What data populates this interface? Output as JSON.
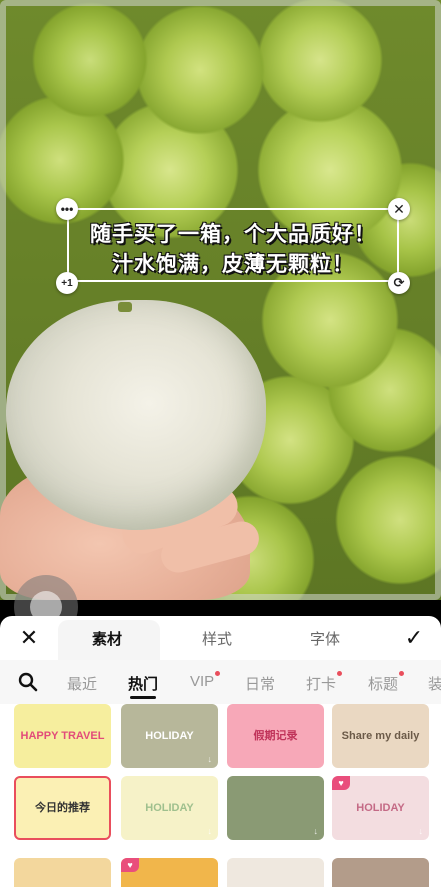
{
  "editor": {
    "sticker": {
      "line1": "随手买了一箱，个大品质好！",
      "line2": "汁水饱满，皮薄无颗粒！",
      "more_icon": "more-icon",
      "close_icon": "close-icon",
      "plus_label": "+1",
      "rotate_icon": "rotate-icon"
    }
  },
  "panel": {
    "tabs": [
      {
        "label": "素材",
        "active": true
      },
      {
        "label": "样式",
        "active": false
      },
      {
        "label": "字体",
        "active": false
      }
    ],
    "close_symbol": "✕",
    "confirm_symbol": "✓",
    "categories": [
      {
        "label": "最近",
        "dot": false,
        "active": false
      },
      {
        "label": "热门",
        "dot": false,
        "active": true
      },
      {
        "label": "VIP",
        "dot": true,
        "active": false
      },
      {
        "label": "日常",
        "dot": false,
        "active": false
      },
      {
        "label": "打卡",
        "dot": true,
        "active": false
      },
      {
        "label": "标题",
        "dot": true,
        "active": false
      },
      {
        "label": "装",
        "dot": false,
        "active": false
      }
    ],
    "tiles": [
      {
        "label": "HAPPY TRAVEL",
        "bg": "#f6ee9e",
        "fg": "#e24b7a",
        "vip": false
      },
      {
        "label": "HOLIDAY",
        "bg": "#b7b79a",
        "fg": "#ffffff",
        "vip": false
      },
      {
        "label": "假期记录",
        "bg": "#f7a8b8",
        "fg": "#c0335a",
        "vip": false
      },
      {
        "label": "Share my daily",
        "bg": "#ead8c2",
        "fg": "#6b5a48",
        "vip": false
      },
      {
        "label": "今日的推荐",
        "bg": "#fbf0b4",
        "fg": "#333333",
        "vip": false,
        "selected": true
      },
      {
        "label": "HOLIDAY",
        "bg": "#f6f2c8",
        "fg": "#9fc08e",
        "vip": false
      },
      {
        "label": "",
        "bg": "#8a9a74",
        "fg": "#ffffff",
        "vip": false
      },
      {
        "label": "HOLIDAY",
        "bg": "#f3dde0",
        "fg": "#c46a86",
        "vip": true
      },
      {
        "label": "",
        "bg": "#f3d79d",
        "fg": "#333333",
        "vip": false
      },
      {
        "label": "",
        "bg": "#f1b64b",
        "fg": "#333333",
        "vip": true
      },
      {
        "label": "",
        "bg": "#efe8df",
        "fg": "#333333",
        "vip": false
      },
      {
        "label": "",
        "bg": "#b39c8a",
        "fg": "#333333",
        "vip": false
      }
    ]
  }
}
